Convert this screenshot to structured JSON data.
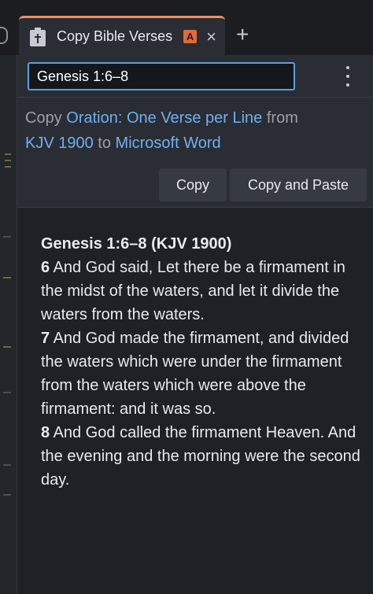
{
  "tab": {
    "title": "Copy Bible Verses",
    "badge": "A",
    "close_glyph": "×",
    "icon": "clipboard-cross-icon"
  },
  "new_tab_glyph": "+",
  "toolbar": {
    "reference_value": "Genesis 1:6–8",
    "menu_icon": "kebab-menu-icon"
  },
  "options": {
    "copy_word": "Copy",
    "format_link": "Oration: One Verse per Line",
    "from_word": "from",
    "version_link": "KJV 1900",
    "to_word": "to",
    "target_link": "Microsoft Word"
  },
  "buttons": {
    "copy_label": "Copy",
    "copy_paste_label": "Copy and Paste"
  },
  "passage": {
    "heading": "Genesis 1:6–8 (KJV 1900)",
    "verses": [
      {
        "num": "6",
        "text": " And God said, Let there be a firmament in the midst of the waters, and let it divide the waters from the waters."
      },
      {
        "num": "7",
        "text": " And God made the firmament, and divided the waters which were under the firmament from the waters which were above the firmament: and it was so."
      },
      {
        "num": "8",
        "text": " And God called the firmament Heaven. And the evening and the morning were the second day."
      }
    ]
  },
  "colors": {
    "accent_tab": "#e8926a",
    "badge": "#e06a3a",
    "link": "#6fb0f2",
    "input_border": "#5a9fe0"
  }
}
